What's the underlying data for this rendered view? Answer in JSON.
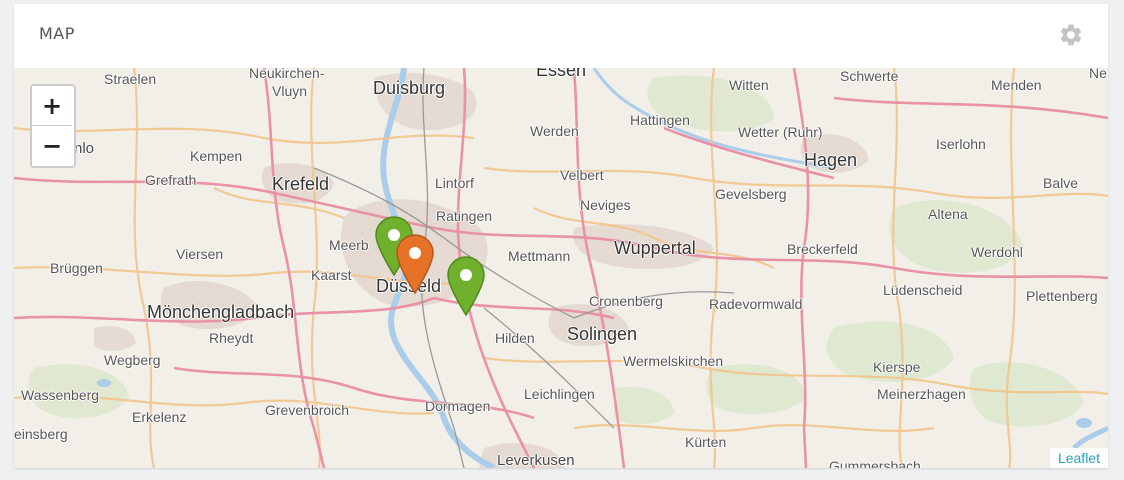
{
  "card": {
    "title": "MAP",
    "settings_icon": "gear-icon"
  },
  "map": {
    "zoom_in_label": "+",
    "zoom_out_label": "−",
    "attribution": "Leaflet",
    "colors": {
      "marker_green": "#6fb12d",
      "marker_orange": "#e67228",
      "road_major": "#e992a6",
      "road_secondary": "#f3c58a",
      "river": "#a9cdea",
      "urban": "#e6d9d1"
    },
    "labels": {
      "straelen": "Straelen",
      "neukirchen": "Neukirchen-",
      "vluyn": "Vluyn",
      "duisburg": "Duisburg",
      "essen": "Essen",
      "schwerte": "Schwerte",
      "ne": "Ne",
      "witten": "Witten",
      "menden": "Menden",
      "venlo": "nlo",
      "werden": "Werden",
      "hattingen": "Hattingen",
      "wetter": "Wetter (Ruhr)",
      "kempen": "Kempen",
      "hagen": "Hagen",
      "iserlohn": "Iserlohn",
      "grefrath": "Grefrath",
      "krefeld": "Krefeld",
      "lintorf": "Lintorf",
      "velbert": "Velbert",
      "gevelsberg": "Gevelsberg",
      "balve": "Balve",
      "neviges": "Neviges",
      "ratingen": "Ratingen",
      "altena": "Altena",
      "meerbusch": "Meerb",
      "viersen": "Viersen",
      "wuppertal": "Wuppertal",
      "breckerfeld": "Breckerfeld",
      "werdohl": "Werdohl",
      "brueggen": "Brüggen",
      "kaarst": "Kaarst",
      "mettmann": "Mettmann",
      "duesseldorf": "Düsseld",
      "luedenscheid": "Lüdenscheid",
      "plettenberg": "Plettenberg",
      "cronenberg": "Cronenberg",
      "radevormwald": "Radevormwald",
      "moenchengladbach": "Mönchengladbach",
      "rheydt": "Rheydt",
      "hilden": "Hilden",
      "solingen": "Solingen",
      "wermelskirchen": "Wermelskirchen",
      "wegberg": "Wegberg",
      "kierspe": "Kierspe",
      "wassenberg": "Wassenberg",
      "meinerzhagen": "Meinerzhagen",
      "erkelenz": "Erkelenz",
      "grevenbroich": "Grevenbroich",
      "dormagen": "Dormagen",
      "leichlingen": "Leichlingen",
      "heinsberg": "einsberg",
      "kuerten": "Kürten",
      "leverkusen": "Leverkusen",
      "gummersbach": "Gummersbach"
    },
    "markers": [
      {
        "name": "marker-green-1",
        "color": "green"
      },
      {
        "name": "marker-orange",
        "color": "orange"
      },
      {
        "name": "marker-green-2",
        "color": "green"
      }
    ]
  }
}
